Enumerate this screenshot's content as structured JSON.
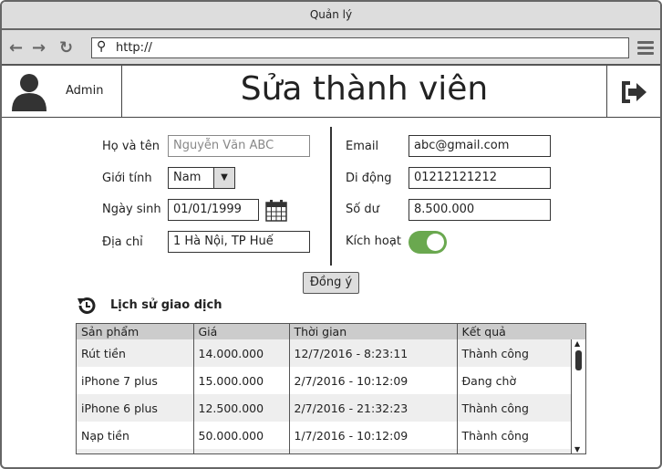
{
  "window": {
    "title": "Quản lý"
  },
  "browser": {
    "url": "http://"
  },
  "header": {
    "user": "Admin",
    "title": "Sửa thành viên"
  },
  "form": {
    "name_label": "Họ và tên",
    "name_placeholder": "Nguyễn Văn ABC",
    "gender_label": "Giới tính",
    "gender_value": "Nam",
    "dob_label": "Ngày sinh",
    "dob_value": "01/01/1999",
    "address_label": "Địa chỉ",
    "address_value": "1 Hà Nội, TP Huế",
    "email_label": "Email",
    "email_value": "abc@gmail.com",
    "phone_label": "Di động",
    "phone_value": "01212121212",
    "balance_label": "Số dư",
    "balance_value": "8.500.000",
    "active_label": "Kích hoạt",
    "active": true,
    "submit": "Đồng ý"
  },
  "history": {
    "title": "Lịch sử giao dịch",
    "columns": [
      "Sản phẩm",
      "Giá",
      "Thời gian",
      "Kết quả"
    ],
    "rows": [
      [
        "Rút tiền",
        "14.000.000",
        "12/7/2016 - 8:23:11",
        "Thành công"
      ],
      [
        "iPhone 7 plus",
        "15.000.000",
        "2/7/2016 - 10:12:09",
        "Đang chờ"
      ],
      [
        "iPhone 6 plus",
        "12.500.000",
        "2/7/2016 - 21:32:23",
        "Thành công"
      ],
      [
        "Nạp tiền",
        "50.000.000",
        "1/7/2016 - 10:12:09",
        "Thành công"
      ]
    ]
  },
  "colors": {
    "toggle_on": "#6aa84f",
    "chrome": "#dddddd"
  }
}
